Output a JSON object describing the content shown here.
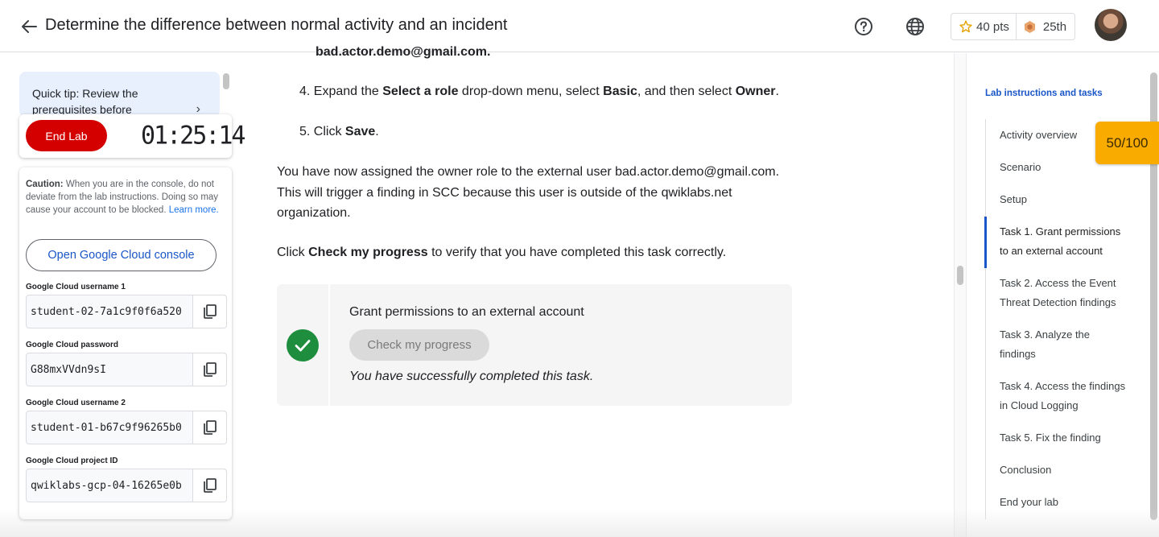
{
  "header": {
    "title": "Determine the difference between normal activity and an incident",
    "points": "40 pts",
    "rank": "25th"
  },
  "left": {
    "tip": "Quick tip: Review the prerequisites before",
    "end_lab": "End Lab",
    "timer": "01:25:14",
    "caution_bold": "Caution:",
    "caution_text": " When you are in the console, do not deviate from the lab instructions. Doing so may cause your account to be blocked. ",
    "learn_more": "Learn more.",
    "console_button": "Open Google Cloud console",
    "fields": [
      {
        "label": "Google Cloud username 1",
        "value": "student-02-7a1c9f0f6a520"
      },
      {
        "label": "Google Cloud password",
        "value": "G88mxVVdn9sI"
      },
      {
        "label": "Google Cloud username 2",
        "value": "student-01-b67c9f96265b0"
      },
      {
        "label": "Google Cloud project ID",
        "value": "qwiklabs-gcp-04-16265e0b"
      }
    ]
  },
  "main": {
    "cut_line": "bad.actor.demo@gmail.com.",
    "step4": {
      "num": "4.",
      "t1": "Expand the ",
      "b1": "Select a role",
      "t2": " drop-down menu, select ",
      "b2": "Basic",
      "t3": ", and then select ",
      "b3": "Owner",
      "t4": "."
    },
    "step5": {
      "num": "5.",
      "t1": "Click ",
      "b1": "Save",
      "t2": "."
    },
    "para1": "You have now assigned the owner role to the external user bad.actor.demo@gmail.com. This will trigger a finding in SCC because this user is outside of the qwiklabs.net organization.",
    "para2": {
      "t1": "Click ",
      "b1": "Check my progress",
      "t2": " to verify that you have completed this task correctly."
    },
    "progress": {
      "title": "Grant permissions to an external account",
      "button": "Check my progress",
      "done": "You have successfully completed this task."
    }
  },
  "toc": {
    "heading": "Lab instructions and tasks",
    "items": [
      "Activity overview",
      "Scenario",
      "Setup",
      "Task 1. Grant permissions to an external account",
      "Task 2. Access the Event Threat Detection findings",
      "Task 3. Analyze the findings",
      "Task 4. Access the findings in Cloud Logging",
      "Task 5. Fix the finding",
      "Conclusion",
      "End your lab"
    ],
    "active_index": 3
  },
  "score_badge": "50/100",
  "colors": {
    "accent": "#1a56c7",
    "end_lab": "#d40000",
    "success": "#1e8e3e",
    "score_badge": "#f9ab00"
  }
}
